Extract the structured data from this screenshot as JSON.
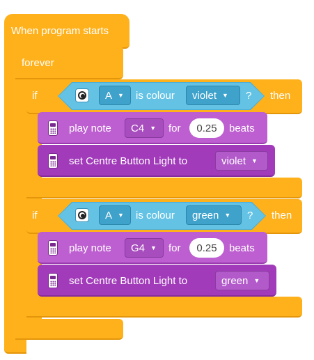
{
  "hat": {
    "label": "When program starts"
  },
  "forever": {
    "label": "forever"
  },
  "if_blocks": [
    {
      "if_label": "if",
      "then_label": "then",
      "condition": {
        "port": "A",
        "operator": "is colour",
        "colour": "violet",
        "question": "?"
      },
      "play_note": {
        "label": "play note",
        "note": "C4",
        "for_label": "for",
        "duration": "0.25",
        "beats_label": "beats"
      },
      "set_light": {
        "label": "set Centre Button Light to",
        "colour": "violet"
      }
    },
    {
      "if_label": "if",
      "then_label": "then",
      "condition": {
        "port": "A",
        "operator": "is colour",
        "colour": "green",
        "question": "?"
      },
      "play_note": {
        "label": "play note",
        "note": "G4",
        "for_label": "for",
        "duration": "0.25",
        "beats_label": "beats"
      },
      "set_light": {
        "label": "set Centre Button Light to",
        "colour": "green"
      }
    }
  ],
  "icons": {
    "dropdown": "chevron-down-icon",
    "sensor": "colour-sensor-icon",
    "hub": "hub-icon"
  },
  "colors": {
    "control": "#FFB11B",
    "sensor": "#4BAFD9",
    "sound": "#BD5FD0",
    "light": "#A23BBA"
  }
}
